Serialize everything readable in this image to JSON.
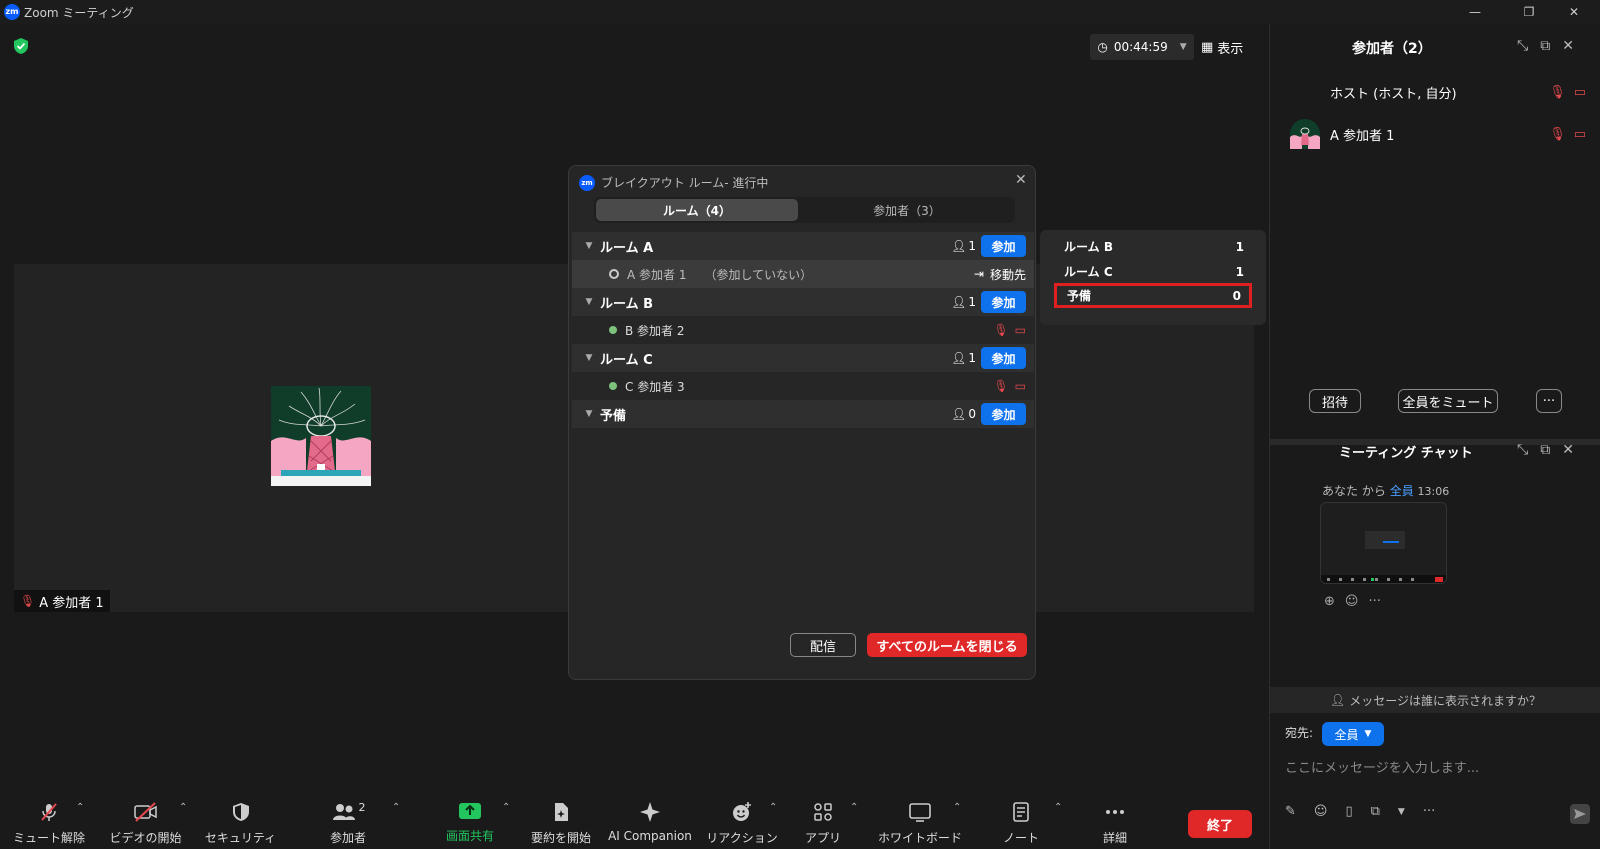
{
  "window": {
    "title": "Zoom ミーティング",
    "logo": "zm"
  },
  "meeting": {
    "timer": "00:44:59",
    "view_label": "表示"
  },
  "video": {
    "tile_name": "A 参加者 1"
  },
  "toolbar": {
    "items": [
      {
        "label": "ミュート解除"
      },
      {
        "label": "ビデオの開始"
      },
      {
        "label": "セキュリティ"
      },
      {
        "label": "参加者",
        "badge": "2"
      },
      {
        "label": "画面共有"
      },
      {
        "label": "要約を開始"
      },
      {
        "label": "AI Companion"
      },
      {
        "label": "リアクション"
      },
      {
        "label": "アプリ"
      },
      {
        "label": "ホワイトボード"
      },
      {
        "label": "ノート"
      },
      {
        "label": "詳細"
      }
    ],
    "end_label": "終了",
    "share_color": "#22c55e",
    "end_color": "#e02828"
  },
  "breakout": {
    "title": "ブレイクアウト ルーム- 進行中",
    "tabs": [
      {
        "label": "ルーム（4）"
      },
      {
        "label": "参加者（3）"
      }
    ],
    "rooms": [
      {
        "name": "ルーム A",
        "count": "1",
        "join": "参加",
        "participants": [
          {
            "name": "A 参加者 1",
            "status": "（参加していない）",
            "action": "移動先"
          }
        ]
      },
      {
        "name": "ルーム B",
        "count": "1",
        "join": "参加",
        "participants": [
          {
            "name": "B 参加者 2"
          }
        ]
      },
      {
        "name": "ルーム C",
        "count": "1",
        "join": "参加",
        "participants": [
          {
            "name": "C 参加者 3"
          }
        ]
      },
      {
        "name": "予備",
        "count": "0",
        "join": "参加",
        "participants": []
      }
    ],
    "broadcast_label": "配信",
    "close_all_label": "すべてのルームを閉じる"
  },
  "move_to": {
    "rows": [
      {
        "name": "ルーム B",
        "count": "1"
      },
      {
        "name": "ルーム C",
        "count": "1"
      },
      {
        "name": "予備",
        "count": "0"
      }
    ]
  },
  "participants_panel": {
    "title": "参加者（2）",
    "list": [
      {
        "name": "ホスト (ホスト, 自分)"
      },
      {
        "name": "A 参加者 1"
      }
    ],
    "invite_label": "招待",
    "mute_all_label": "全員をミュート",
    "more_label": "···"
  },
  "chat_panel": {
    "title": "ミーティング チャット",
    "sender": "あなた",
    "from_text": "から",
    "recipient": "全員",
    "time": "13:06",
    "who_sees": "メッセージは誰に表示されますか？",
    "to_label": "宛先:",
    "to_value": "全員",
    "input_placeholder": "ここにメッセージを入力します..."
  }
}
